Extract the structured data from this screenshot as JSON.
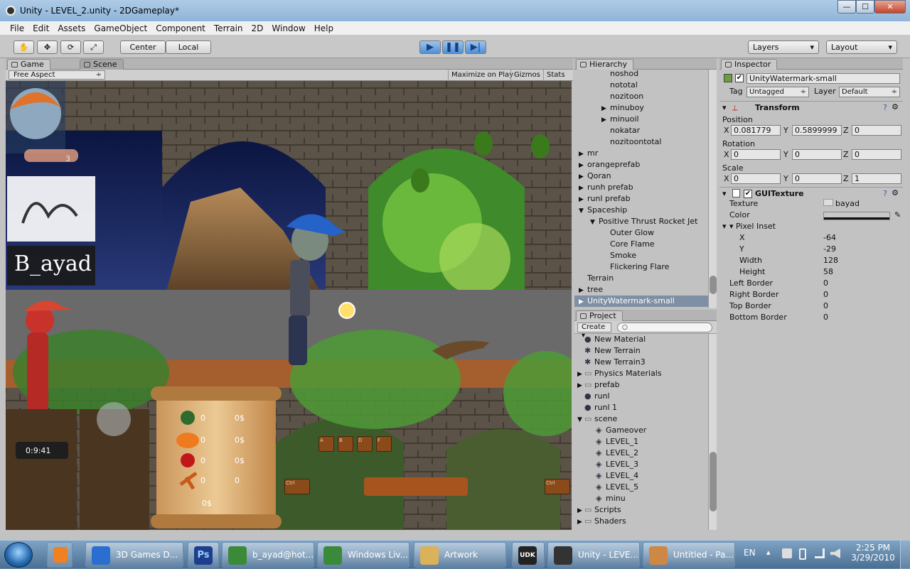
{
  "window": {
    "title": "Unity - LEVEL_2.unity - 2DGameplay*",
    "min": "—",
    "max": "☐",
    "close": "✕"
  },
  "menu": [
    "File",
    "Edit",
    "Assets",
    "GameObject",
    "Component",
    "Terrain",
    "2D",
    "Window",
    "Help"
  ],
  "toolbar": {
    "center": "Center",
    "local": "Local",
    "layers": "Layers",
    "layout": "Layout",
    "tools": [
      "hand-icon",
      "move-icon",
      "rotate-icon",
      "scale-icon"
    ]
  },
  "tabs": {
    "game": "Game",
    "scene": "Scene",
    "hierarchy": "Hierarchy",
    "inspector": "Inspector",
    "project": "Project"
  },
  "gamebar": {
    "aspect": "Free Aspect",
    "maximize": "Maximize on Play",
    "gizmos": "Gizmos",
    "stats": "Stats"
  },
  "hud": {
    "lives": "3",
    "name": "B_ayad",
    "timer": "0:9:41",
    "scores": [
      {
        "count": "0",
        "cash": "0$"
      },
      {
        "count": "0",
        "cash": "0$"
      },
      {
        "count": "0",
        "cash": "0$"
      },
      {
        "count": "0",
        "cash": "0"
      }
    ],
    "total": "0$",
    "keys": [
      "A",
      "B",
      "D",
      "F"
    ],
    "ctrl": "Ctrl"
  },
  "hierarchy": [
    {
      "t": "noshod",
      "d": 2,
      "a": 0
    },
    {
      "t": "nototal",
      "d": 2,
      "a": 0
    },
    {
      "t": "nozitoon",
      "d": 2,
      "a": 0
    },
    {
      "t": "minuboy",
      "d": 2,
      "a": 1
    },
    {
      "t": "minuoil",
      "d": 2,
      "a": 1
    },
    {
      "t": "nokatar",
      "d": 2,
      "a": 0
    },
    {
      "t": "nozitoontotal",
      "d": 2,
      "a": 0
    },
    {
      "t": "mr",
      "d": 0,
      "a": 1
    },
    {
      "t": "orangeprefab",
      "d": 0,
      "a": 1
    },
    {
      "t": "Qoran",
      "d": 0,
      "a": 1
    },
    {
      "t": "runh prefab",
      "d": 0,
      "a": 1
    },
    {
      "t": "runl prefab",
      "d": 0,
      "a": 1
    },
    {
      "t": "Spaceship",
      "d": 0,
      "a": 2
    },
    {
      "t": "Positive Thrust Rocket Jet",
      "d": 1,
      "a": 2
    },
    {
      "t": "Outer Glow",
      "d": 2,
      "a": 0
    },
    {
      "t": "Core Flame",
      "d": 2,
      "a": 0
    },
    {
      "t": "Smoke",
      "d": 2,
      "a": 0
    },
    {
      "t": "Flickering Flare",
      "d": 2,
      "a": 0
    },
    {
      "t": "Terrain",
      "d": 0,
      "a": 0
    },
    {
      "t": "tree",
      "d": 0,
      "a": 1
    },
    {
      "t": "UnityWatermark-small",
      "d": 0,
      "a": 1,
      "sel": true
    }
  ],
  "project": {
    "create": "Create ▾",
    "items": [
      {
        "t": "New Material",
        "i": "ball",
        "d": 0
      },
      {
        "t": "New Terrain",
        "i": "terrain",
        "d": 0
      },
      {
        "t": "New Terrain3",
        "i": "terrain",
        "d": 0
      },
      {
        "t": "Physics Materials",
        "i": "folder",
        "d": 0,
        "a": 1
      },
      {
        "t": "prefab",
        "i": "folder",
        "d": 0,
        "a": 1
      },
      {
        "t": "runl",
        "i": "ball",
        "d": 0
      },
      {
        "t": "runl 1",
        "i": "ball",
        "d": 0
      },
      {
        "t": "scene",
        "i": "folder",
        "d": 0,
        "a": 2
      },
      {
        "t": "Gameover",
        "i": "unity",
        "d": 1
      },
      {
        "t": "LEVEL_1",
        "i": "unity",
        "d": 1
      },
      {
        "t": "LEVEL_2",
        "i": "unity",
        "d": 1
      },
      {
        "t": "LEVEL_3",
        "i": "unity",
        "d": 1
      },
      {
        "t": "LEVEL_4",
        "i": "unity",
        "d": 1
      },
      {
        "t": "LEVEL_5",
        "i": "unity",
        "d": 1
      },
      {
        "t": "minu",
        "i": "unity",
        "d": 1
      },
      {
        "t": "Scripts",
        "i": "folder",
        "d": 0,
        "a": 1
      },
      {
        "t": "Shaders",
        "i": "folder",
        "d": 0,
        "a": 1
      }
    ]
  },
  "inspector": {
    "name": "UnityWatermark-small",
    "tagLabel": "Tag",
    "tag": "Untagged",
    "layerLabel": "Layer",
    "layer": "Default",
    "transform": "Transform",
    "position": {
      "label": "Position",
      "x": "0.081779",
      "y": "0.5899999",
      "z": "0"
    },
    "rotation": {
      "label": "Rotation",
      "x": "0",
      "y": "0",
      "z": "0"
    },
    "scale": {
      "label": "Scale",
      "x": "0",
      "y": "0",
      "z": "1"
    },
    "guitexture": "GUITexture",
    "props": [
      {
        "k": "Texture",
        "v": "bayad"
      },
      {
        "k": "Color",
        "v": ""
      }
    ],
    "pixelInset": "Pixel Inset",
    "inset": [
      {
        "k": "X",
        "v": "-64"
      },
      {
        "k": "Y",
        "v": "-29"
      },
      {
        "k": "Width",
        "v": "128"
      },
      {
        "k": "Height",
        "v": "58"
      }
    ],
    "borders": [
      {
        "k": "Left Border",
        "v": "0"
      },
      {
        "k": "Right Border",
        "v": "0"
      },
      {
        "k": "Top Border",
        "v": "0"
      },
      {
        "k": "Bottom Border",
        "v": "0"
      }
    ]
  },
  "taskbar": {
    "items": [
      {
        "t": "3D Games D...",
        "c": "#2a6ed0"
      },
      {
        "t": "",
        "c": "#1c3e8c",
        "ps": "Ps"
      },
      {
        "t": "b_ayad@hot...",
        "c": "#3a8a3a"
      },
      {
        "t": "Windows Liv...",
        "c": "#3a8a3a"
      },
      {
        "t": "Artwork",
        "c": "#d9b25a"
      },
      {
        "t": "",
        "c": "#222",
        "udk": "UDK"
      },
      {
        "t": "Unity - LEVE...",
        "c": "#333"
      },
      {
        "t": "Untitled - Pa...",
        "c": "#c84"
      }
    ],
    "lang": "EN",
    "time": "2:25 PM",
    "date": "3/29/2010"
  }
}
